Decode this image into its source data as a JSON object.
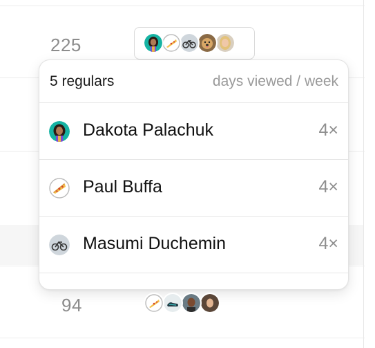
{
  "table": {
    "rows": [
      {
        "count": "225"
      },
      {
        "count": "94"
      }
    ]
  },
  "popover": {
    "title": "5 regulars",
    "subtitle": "days viewed / week",
    "regulars": [
      {
        "name": "Dakota Palachuk",
        "count": "4×",
        "avatar": "woman-portrait"
      },
      {
        "name": "Paul Buffa",
        "count": "4×",
        "avatar": "pizza-emoji"
      },
      {
        "name": "Masumi Duchemin",
        "count": "4×",
        "avatar": "bicycle-photo"
      }
    ]
  },
  "colors": {
    "accent_teal": "#16b3a3",
    "muted_text": "#8c8c8c",
    "border": "#e3e3e3"
  }
}
